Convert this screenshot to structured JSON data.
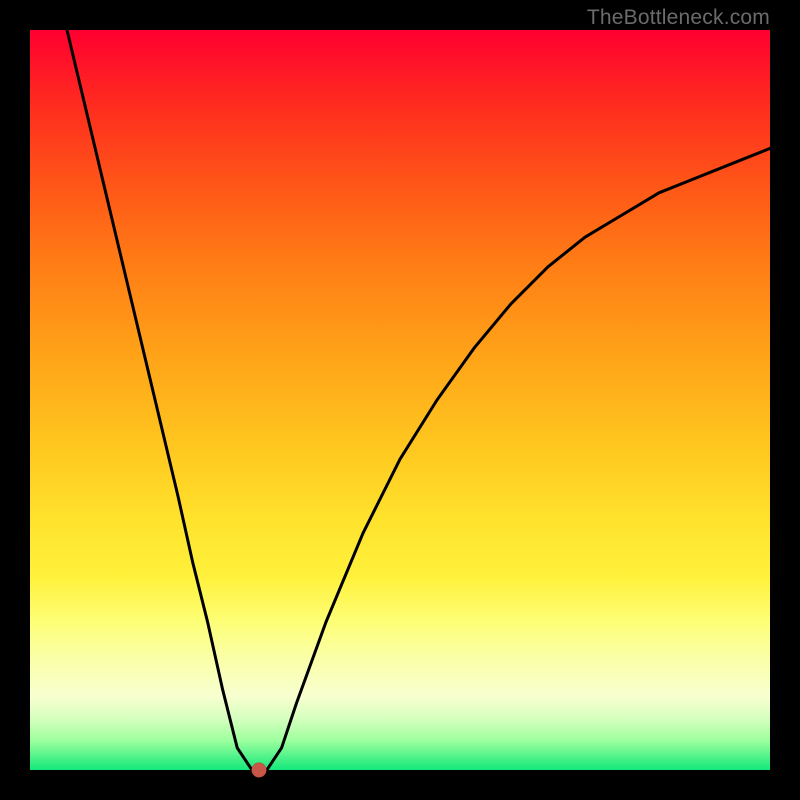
{
  "watermark": "TheBottleneck.com",
  "chart_data": {
    "type": "line",
    "title": "",
    "xlabel": "",
    "ylabel": "",
    "xlim": [
      0,
      100
    ],
    "ylim": [
      0,
      100
    ],
    "gradient_meaning": "background color indicates bottleneck severity: red=high, green=low",
    "series": [
      {
        "name": "bottleneck-curve",
        "x": [
          5,
          10,
          15,
          20,
          22,
          24,
          26,
          28,
          30,
          32,
          34,
          36,
          40,
          45,
          50,
          55,
          60,
          65,
          70,
          75,
          80,
          85,
          90,
          95,
          100
        ],
        "y": [
          100,
          79,
          58,
          37,
          28,
          20,
          11,
          3,
          0,
          0,
          3,
          9,
          20,
          32,
          42,
          50,
          57,
          63,
          68,
          72,
          75,
          78,
          80,
          82,
          84
        ]
      }
    ],
    "marker": {
      "x": 31,
      "y": 0,
      "color": "#c8574a"
    }
  }
}
